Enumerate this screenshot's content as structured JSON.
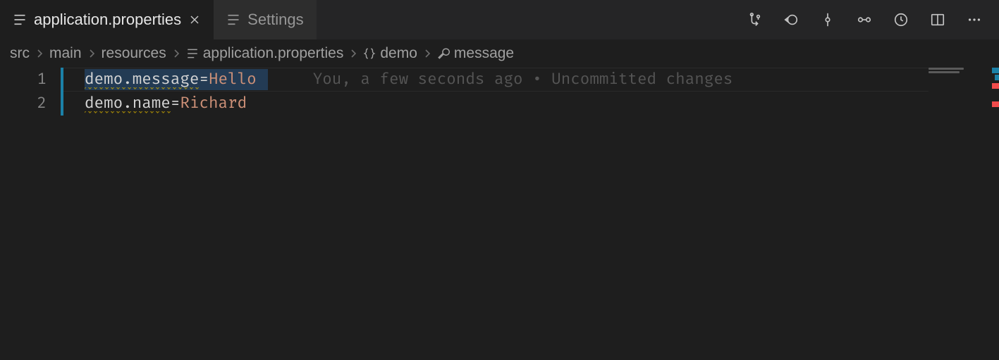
{
  "tabs": [
    {
      "label": "application.properties",
      "active": true,
      "closeable": true
    },
    {
      "label": "Settings",
      "active": false,
      "closeable": false
    }
  ],
  "breadcrumbs": {
    "path": [
      "src",
      "main",
      "resources"
    ],
    "file": "application.properties",
    "symbols": [
      "demo",
      "message"
    ]
  },
  "editor": {
    "lines": [
      {
        "num": "1",
        "key": "demo.message",
        "eq": "=",
        "val": "Hello",
        "blame": "You, a few seconds ago • Uncommitted changes",
        "selected": true
      },
      {
        "num": "2",
        "key": "demo.name",
        "eq": "=",
        "val": "Richard"
      }
    ]
  },
  "colors": {
    "key": "#d4d4d4",
    "value": "#ce9178",
    "gutter_bar": "#1b81a8"
  }
}
